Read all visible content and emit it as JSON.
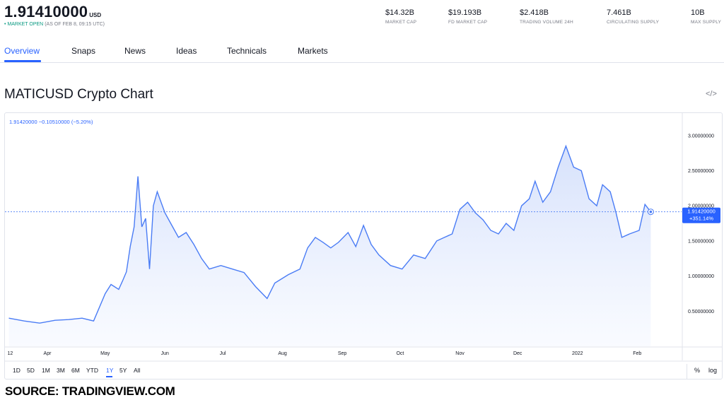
{
  "header": {
    "price": "1.91410000",
    "currency": "USD",
    "status_dot": "•",
    "market_status": "MARKET OPEN",
    "as_of": "(AS OF FEB 8, 09:15 UTC)"
  },
  "stats": [
    {
      "value": "$14.32B",
      "label": "MARKET CAP"
    },
    {
      "value": "$19.193B",
      "label": "FD MARKET CAP"
    },
    {
      "value": "$2.418B",
      "label": "TRADING VOLUME 24H"
    },
    {
      "value": "7.461B",
      "label": "CIRCULATING SUPPLY"
    },
    {
      "value": "10B",
      "label": "MAX SUPPLY"
    }
  ],
  "tabs": [
    {
      "label": "Overview",
      "active": true
    },
    {
      "label": "Snaps",
      "active": false
    },
    {
      "label": "News",
      "active": false
    },
    {
      "label": "Ideas",
      "active": false
    },
    {
      "label": "Technicals",
      "active": false
    },
    {
      "label": "Markets",
      "active": false
    }
  ],
  "chart_title": "MATICUSD Crypto Chart",
  "embed_icon": "</>",
  "legend": {
    "price": "1.91420000",
    "change": "−0.10510000",
    "change_pct": "(−5.20%)"
  },
  "last_price_label": "1.91420000",
  "last_change_label": "+351.14%",
  "colors": {
    "accent": "#2962ff",
    "line": "#4a7cf5",
    "fill_top": "#cfdcfb",
    "fill_bottom": "#f5f8ff",
    "text": "#131722",
    "muted": "#787b86",
    "positive": "#089981"
  },
  "chart_data": {
    "type": "area",
    "series": [
      {
        "values": [
          {
            "x": "2021-03-12",
            "y": 0.4
          },
          {
            "x": "2021-03-20",
            "y": 0.36
          },
          {
            "x": "2021-03-28",
            "y": 0.33
          },
          {
            "x": "2021-04-05",
            "y": 0.37
          },
          {
            "x": "2021-04-12",
            "y": 0.38
          },
          {
            "x": "2021-04-19",
            "y": 0.4
          },
          {
            "x": "2021-04-25",
            "y": 0.36
          },
          {
            "x": "2021-05-01",
            "y": 0.75
          },
          {
            "x": "2021-05-04",
            "y": 0.88
          },
          {
            "x": "2021-05-08",
            "y": 0.81
          },
          {
            "x": "2021-05-10",
            "y": 0.93
          },
          {
            "x": "2021-05-12",
            "y": 1.06
          },
          {
            "x": "2021-05-14",
            "y": 1.42
          },
          {
            "x": "2021-05-16",
            "y": 1.7
          },
          {
            "x": "2021-05-18",
            "y": 2.42
          },
          {
            "x": "2021-05-20",
            "y": 1.7
          },
          {
            "x": "2021-05-22",
            "y": 1.82
          },
          {
            "x": "2021-05-24",
            "y": 1.1
          },
          {
            "x": "2021-05-26",
            "y": 2.0
          },
          {
            "x": "2021-05-28",
            "y": 2.2
          },
          {
            "x": "2021-06-01",
            "y": 1.9
          },
          {
            "x": "2021-06-04",
            "y": 1.75
          },
          {
            "x": "2021-06-08",
            "y": 1.55
          },
          {
            "x": "2021-06-12",
            "y": 1.62
          },
          {
            "x": "2021-06-16",
            "y": 1.45
          },
          {
            "x": "2021-06-20",
            "y": 1.25
          },
          {
            "x": "2021-06-24",
            "y": 1.1
          },
          {
            "x": "2021-06-30",
            "y": 1.15
          },
          {
            "x": "2021-07-06",
            "y": 1.1
          },
          {
            "x": "2021-07-12",
            "y": 1.05
          },
          {
            "x": "2021-07-18",
            "y": 0.85
          },
          {
            "x": "2021-07-24",
            "y": 0.68
          },
          {
            "x": "2021-07-28",
            "y": 0.9
          },
          {
            "x": "2021-08-04",
            "y": 1.02
          },
          {
            "x": "2021-08-10",
            "y": 1.1
          },
          {
            "x": "2021-08-14",
            "y": 1.4
          },
          {
            "x": "2021-08-18",
            "y": 1.55
          },
          {
            "x": "2021-08-22",
            "y": 1.48
          },
          {
            "x": "2021-08-26",
            "y": 1.4
          },
          {
            "x": "2021-08-30",
            "y": 1.48
          },
          {
            "x": "2021-09-04",
            "y": 1.62
          },
          {
            "x": "2021-09-08",
            "y": 1.42
          },
          {
            "x": "2021-09-12",
            "y": 1.72
          },
          {
            "x": "2021-09-16",
            "y": 1.45
          },
          {
            "x": "2021-09-20",
            "y": 1.3
          },
          {
            "x": "2021-09-26",
            "y": 1.15
          },
          {
            "x": "2021-10-02",
            "y": 1.1
          },
          {
            "x": "2021-10-08",
            "y": 1.3
          },
          {
            "x": "2021-10-14",
            "y": 1.25
          },
          {
            "x": "2021-10-20",
            "y": 1.5
          },
          {
            "x": "2021-10-24",
            "y": 1.55
          },
          {
            "x": "2021-10-28",
            "y": 1.6
          },
          {
            "x": "2021-11-01",
            "y": 1.95
          },
          {
            "x": "2021-11-05",
            "y": 2.05
          },
          {
            "x": "2021-11-09",
            "y": 1.9
          },
          {
            "x": "2021-11-13",
            "y": 1.8
          },
          {
            "x": "2021-11-17",
            "y": 1.65
          },
          {
            "x": "2021-11-21",
            "y": 1.6
          },
          {
            "x": "2021-11-25",
            "y": 1.75
          },
          {
            "x": "2021-11-29",
            "y": 1.65
          },
          {
            "x": "2021-12-03",
            "y": 2.0
          },
          {
            "x": "2021-12-07",
            "y": 2.1
          },
          {
            "x": "2021-12-10",
            "y": 2.35
          },
          {
            "x": "2021-12-14",
            "y": 2.05
          },
          {
            "x": "2021-12-18",
            "y": 2.2
          },
          {
            "x": "2021-12-22",
            "y": 2.55
          },
          {
            "x": "2021-12-26",
            "y": 2.85
          },
          {
            "x": "2021-12-30",
            "y": 2.55
          },
          {
            "x": "2022-01-03",
            "y": 2.5
          },
          {
            "x": "2022-01-07",
            "y": 2.1
          },
          {
            "x": "2022-01-11",
            "y": 2.0
          },
          {
            "x": "2022-01-14",
            "y": 2.3
          },
          {
            "x": "2022-01-18",
            "y": 2.2
          },
          {
            "x": "2022-01-21",
            "y": 1.9
          },
          {
            "x": "2022-01-24",
            "y": 1.55
          },
          {
            "x": "2022-01-28",
            "y": 1.6
          },
          {
            "x": "2022-02-02",
            "y": 1.65
          },
          {
            "x": "2022-02-05",
            "y": 2.02
          },
          {
            "x": "2022-02-08",
            "y": 1.914
          }
        ]
      }
    ],
    "x_tick_labels": [
      {
        "x": "2021-03-12",
        "label": "12"
      },
      {
        "x": "2021-04-01",
        "label": "Apr"
      },
      {
        "x": "2021-05-01",
        "label": "May"
      },
      {
        "x": "2021-06-01",
        "label": "Jun"
      },
      {
        "x": "2021-07-01",
        "label": "Jul"
      },
      {
        "x": "2021-08-01",
        "label": "Aug"
      },
      {
        "x": "2021-09-01",
        "label": "Sep"
      },
      {
        "x": "2021-10-01",
        "label": "Oct"
      },
      {
        "x": "2021-11-01",
        "label": "Nov"
      },
      {
        "x": "2021-12-01",
        "label": "Dec"
      },
      {
        "x": "2022-01-01",
        "label": "2022"
      },
      {
        "x": "2022-02-01",
        "label": "Feb"
      }
    ],
    "y_ticks": [
      {
        "value": 0.5,
        "label": "0.50000000"
      },
      {
        "value": 1.0,
        "label": "1.00000000"
      },
      {
        "value": 1.5,
        "label": "1.50000000"
      },
      {
        "value": 2.0,
        "label": "2.00000000"
      },
      {
        "value": 2.5,
        "label": "2.50000000"
      },
      {
        "value": 3.0,
        "label": "3.00000000"
      }
    ],
    "xlim": [
      "2021-03-10",
      "2022-02-24"
    ],
    "ylim": [
      0.0,
      3.3
    ],
    "grid": false,
    "last_value": 1.9142
  },
  "ranges": [
    {
      "label": "1D",
      "active": false
    },
    {
      "label": "5D",
      "active": false
    },
    {
      "label": "1M",
      "active": false
    },
    {
      "label": "3M",
      "active": false
    },
    {
      "label": "6M",
      "active": false
    },
    {
      "label": "YTD",
      "active": false
    },
    {
      "label": "1Y",
      "active": true
    },
    {
      "label": "5Y",
      "active": false
    },
    {
      "label": "All",
      "active": false
    }
  ],
  "options": {
    "percent": "%",
    "log": "log"
  },
  "source": "SOURCE: TRADINGVIEW.COM"
}
